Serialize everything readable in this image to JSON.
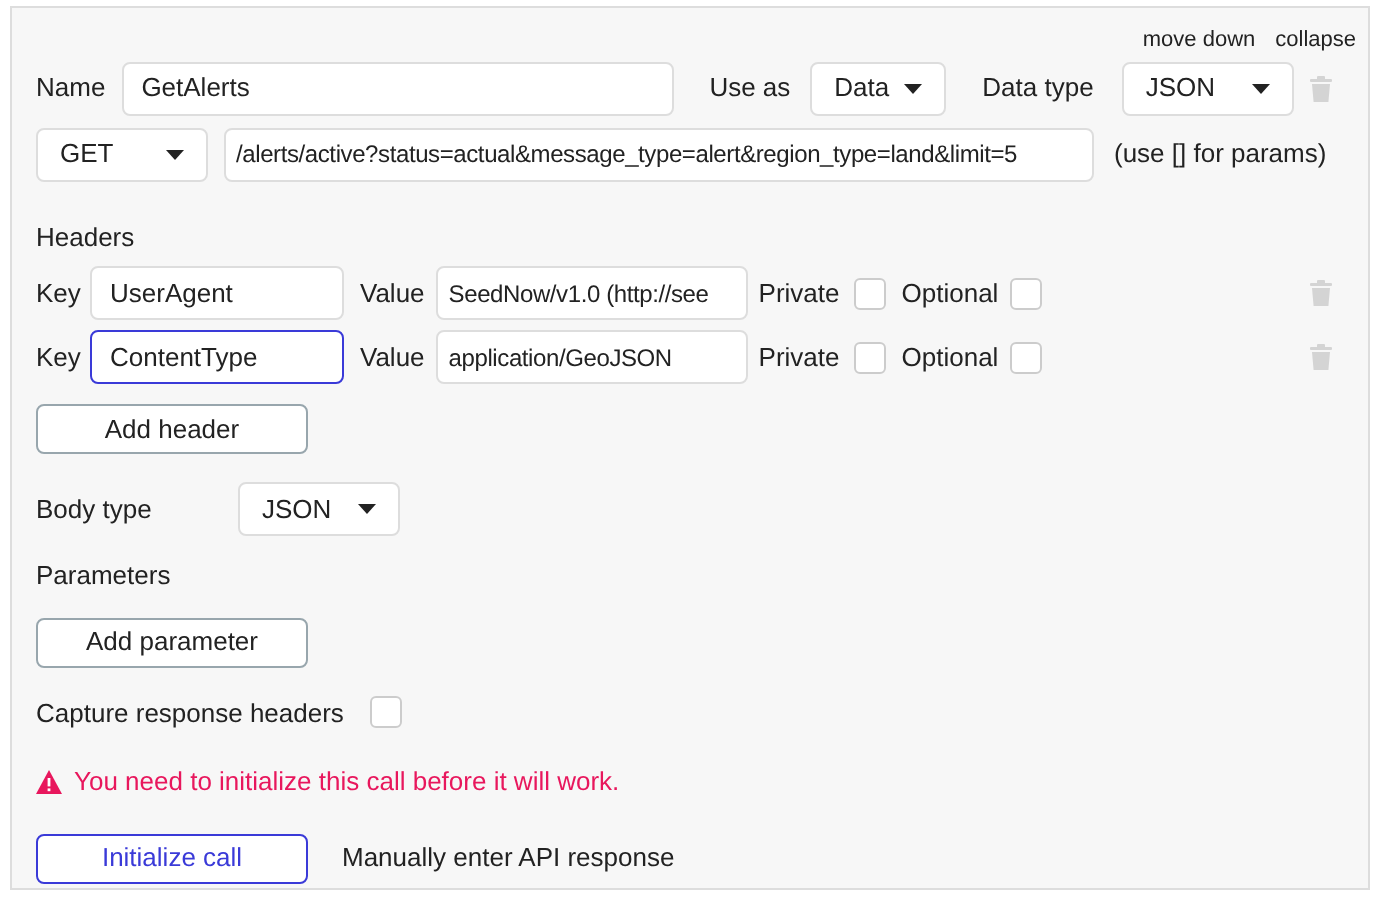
{
  "top_links": [
    "move down",
    "collapse"
  ],
  "name": {
    "label": "Name",
    "value": "GetAlerts"
  },
  "use_as": {
    "label": "Use as",
    "value": "Data"
  },
  "data_type": {
    "label": "Data type",
    "value": "JSON"
  },
  "method": {
    "value": "GET"
  },
  "url": {
    "value": "/alerts/active?status=actual&message_type=alert&region_type=land&limit=5",
    "hint": "(use [] for params)"
  },
  "headers": {
    "title": "Headers",
    "rows": [
      {
        "key_label": "Key",
        "key": "UserAgent",
        "focused": false,
        "value_label": "Value",
        "value": "SeedNow/v1.0 (http://see",
        "private_label": "Private",
        "private": false,
        "optional_label": "Optional",
        "optional": false
      },
      {
        "key_label": "Key",
        "key": "ContentType",
        "focused": true,
        "value_label": "Value",
        "value": "application/GeoJSON",
        "private_label": "Private",
        "private": false,
        "optional_label": "Optional",
        "optional": false
      }
    ],
    "add_button": "Add header"
  },
  "body_type": {
    "label": "Body type",
    "value": "JSON"
  },
  "parameters": {
    "title": "Parameters",
    "add_button": "Add parameter"
  },
  "capture": {
    "label": "Capture response headers",
    "checked": false
  },
  "warning": "You need to initialize this call before it will work.",
  "initialize_button": "Initialize call",
  "manual_link": "Manually enter API response"
}
